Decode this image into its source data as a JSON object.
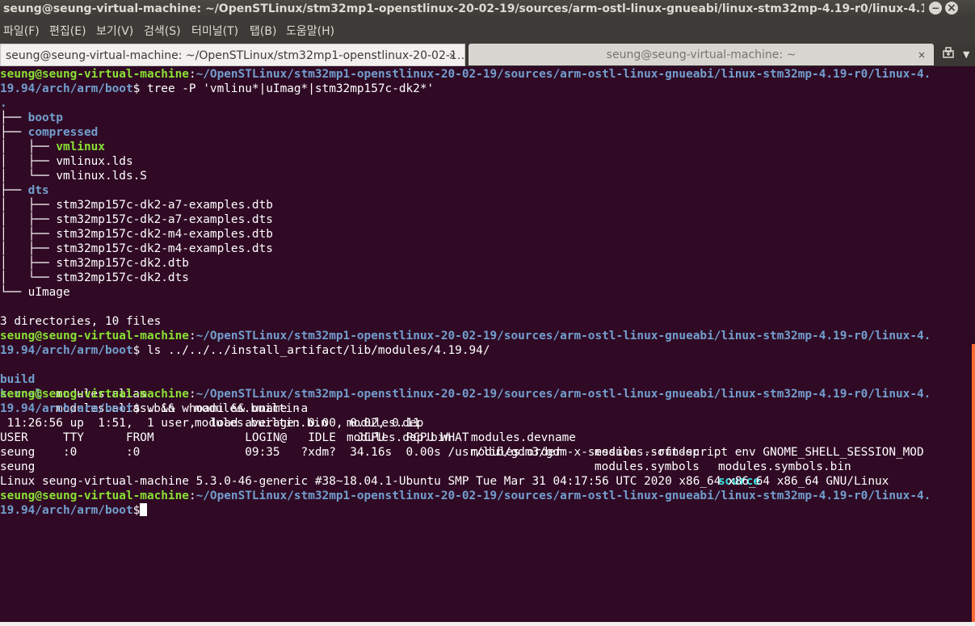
{
  "window": {
    "title": "seung@seung-virtual-machine: ~/OpenSTLinux/stm32mp1-openstlinux-20-02-19/sources/arm-ostl-linux-gnueabi/linux-stm32mp-4.19-r0/linux-4.19.94/arch/arm/b…",
    "minimize_glyph": "−",
    "close_glyph": "×"
  },
  "menu": [
    "파일(F)",
    "편집(E)",
    "보기(V)",
    "검색(S)",
    "터미널(T)",
    "탭(B)",
    "도움말(H)"
  ],
  "tabs": [
    {
      "label": "seung@seung-virtual-machine: ~/OpenSTLinux/stm32mp1-openstlinux-20-02-1…",
      "close": "×"
    },
    {
      "label": "seung@seung-virtual-machine: ~",
      "close": "×"
    }
  ],
  "icons": {
    "new_tab": "new-tab-icon",
    "dropdown": "chevron-down-icon",
    "cursor": "block-cursor"
  },
  "colors": {
    "background": "#300a24",
    "user": "#8ae234",
    "path": "#729fcf",
    "link": "#34e2e2",
    "text": "#ffffff"
  },
  "prompt": {
    "user": "seung@seung-virtual-machine",
    "path_line1": "~/OpenSTLinux/stm32mp1-openstlinux-20-02-19/sources/arm-ostl-linux-gnueabi/linux-stm32mp-4.19-r0/linux-4.",
    "path_line2": "19.94/arch/arm/boot"
  },
  "terminal": {
    "cmd1": "tree -P 'vmlinu*|uImag*|stm32mp157c-dk2*'",
    "tree_root": ".",
    "tree": {
      "bootp": "bootp",
      "compressed": "compressed",
      "vmlinux": "vmlinux",
      "vmlinux_lds": "vmlinux.lds",
      "vmlinux_lds_s": "vmlinux.lds.S",
      "dts": "dts",
      "dts_files": [
        "stm32mp157c-dk2-a7-examples.dtb",
        "stm32mp157c-dk2-a7-examples.dts",
        "stm32mp157c-dk2-m4-examples.dtb",
        "stm32mp157c-dk2-m4-examples.dts",
        "stm32mp157c-dk2.dtb",
        "stm32mp157c-dk2.dts"
      ],
      "uimage": "uImage"
    },
    "tree_summary": "3 directories, 10 files",
    "cmd2": "ls ../../../install_artifact/lib/modules/4.19.94/",
    "ls_row1": [
      "build",
      "modules.alias",
      "modules.builtin",
      "modules.dep",
      "modules.devname",
      "modules.softdep",
      "modules.symbols.bin"
    ],
    "ls_row2": [
      "kernel",
      "modules.alias.bin",
      "modules.builtin.bin",
      "modules.dep.bin",
      "modules.order",
      "modules.symbols",
      "source"
    ],
    "cmd3": "w && whoami && uname -a",
    "w_uptime": " 11:26:56 up  1:51,  1 user,  load average: 0.00, 0.02, 0.11",
    "w_header": "USER     TTY      FROM             LOGIN@   IDLE   JCPU   PCPU WHAT",
    "w_row": "seung    :0       :0               09:35   ?xdm?  34.16s  0.00s /usr/lib/gdm3/gdm-x-session --run-script env GNOME_SHELL_SESSION_MOD",
    "whoami": "seung",
    "uname": "Linux seung-virtual-machine 5.3.0-46-generic #38~18.04.1-Ubuntu SMP Tue Mar 31 04:17:56 UTC 2020 x86_64 x86_64 x86_64 GNU/Linux"
  }
}
